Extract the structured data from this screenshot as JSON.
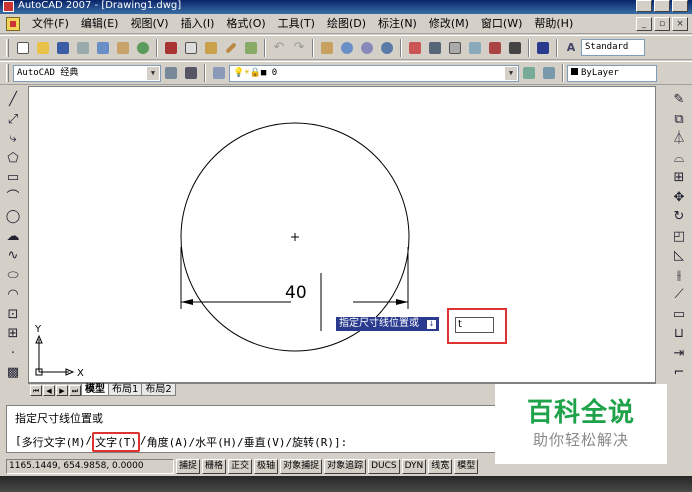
{
  "window": {
    "title": "AutoCAD 2007 - [Drawing1.dwg]"
  },
  "menu": [
    "文件(F)",
    "编辑(E)",
    "视图(V)",
    "插入(I)",
    "格式(O)",
    "工具(T)",
    "绘图(D)",
    "标注(N)",
    "修改(M)",
    "窗口(W)",
    "帮助(H)"
  ],
  "toolbar": {
    "text_style": "Standard",
    "workspace": "AutoCAD 经典",
    "layer": "0",
    "color": "ByLayer"
  },
  "drawing": {
    "dimension_text": "40"
  },
  "dynamic_input": {
    "prompt": "指定尺寸线位置或",
    "value": "t"
  },
  "layout_tabs": [
    "模型",
    "布局1",
    "布局2"
  ],
  "command": {
    "line1": "指定尺寸线位置或",
    "opt_open": "[",
    "opt_mtext": "多行文字(M)",
    "opt_sep1": "/",
    "opt_text": "文字(T)",
    "opt_sep2": "/",
    "opt_rest": "角度(A)/水平(H)/垂直(V)/旋转(R)]:"
  },
  "status": {
    "coords": "1165.1449, 654.9858, 0.0000",
    "buttons": [
      "捕捉",
      "栅格",
      "正交",
      "极轴",
      "对象捕捉",
      "对象追踪",
      "DUCS",
      "DYN",
      "线宽",
      "模型"
    ]
  },
  "watermark": {
    "title": "百科全说",
    "subtitle": "助你轻松解决"
  },
  "colors": {
    "accent": "#2a3b8f",
    "highlight": "#dd3333",
    "watermark_green": "#1fa34a"
  },
  "ucs": {
    "y_label": "Y",
    "x_label": "X"
  }
}
